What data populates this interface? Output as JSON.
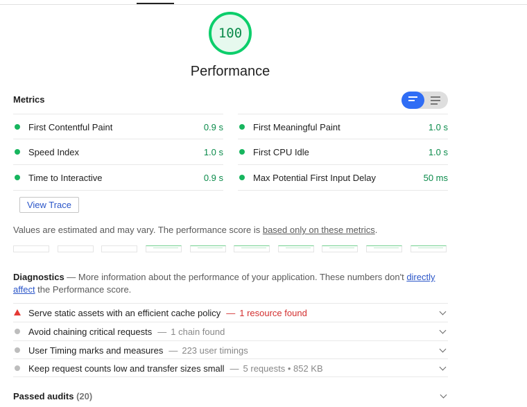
{
  "score": {
    "value": "100",
    "title": "Performance",
    "color": "#0cce6b",
    "bg": "#e6f9ee"
  },
  "metrics": {
    "heading": "Metrics",
    "left": [
      {
        "label": "First Contentful Paint",
        "value": "0.9 s"
      },
      {
        "label": "Speed Index",
        "value": "1.0 s"
      },
      {
        "label": "Time to Interactive",
        "value": "0.9 s"
      }
    ],
    "right": [
      {
        "label": "First Meaningful Paint",
        "value": "1.0 s"
      },
      {
        "label": "First CPU Idle",
        "value": "1.0 s"
      },
      {
        "label": "Max Potential First Input Delay",
        "value": "50 ms"
      }
    ],
    "status_color": "#17b55e"
  },
  "view_trace_label": "View Trace",
  "note": {
    "text": "Values are estimated and may vary. The performance score is ",
    "link": "based only on these metrics",
    "end": "."
  },
  "diagnostics": {
    "heading": "Diagnostics",
    "desc1": " — More information about the performance of your application. These numbers don't ",
    "link": "directly affect",
    "desc2": " the Performance score.",
    "items": [
      {
        "title": "Serve static assets with an efficient cache policy",
        "summary": "1 resource found",
        "status": "fail"
      },
      {
        "title": "Avoid chaining critical requests",
        "summary": "1 chain found",
        "status": "info"
      },
      {
        "title": "User Timing marks and measures",
        "summary": "223 user timings",
        "status": "info"
      },
      {
        "title": "Keep request counts low and transfer sizes small",
        "summary": "5 requests • 852 KB",
        "status": "info"
      }
    ]
  },
  "passed": {
    "label": "Passed audits",
    "count": "(20)"
  }
}
